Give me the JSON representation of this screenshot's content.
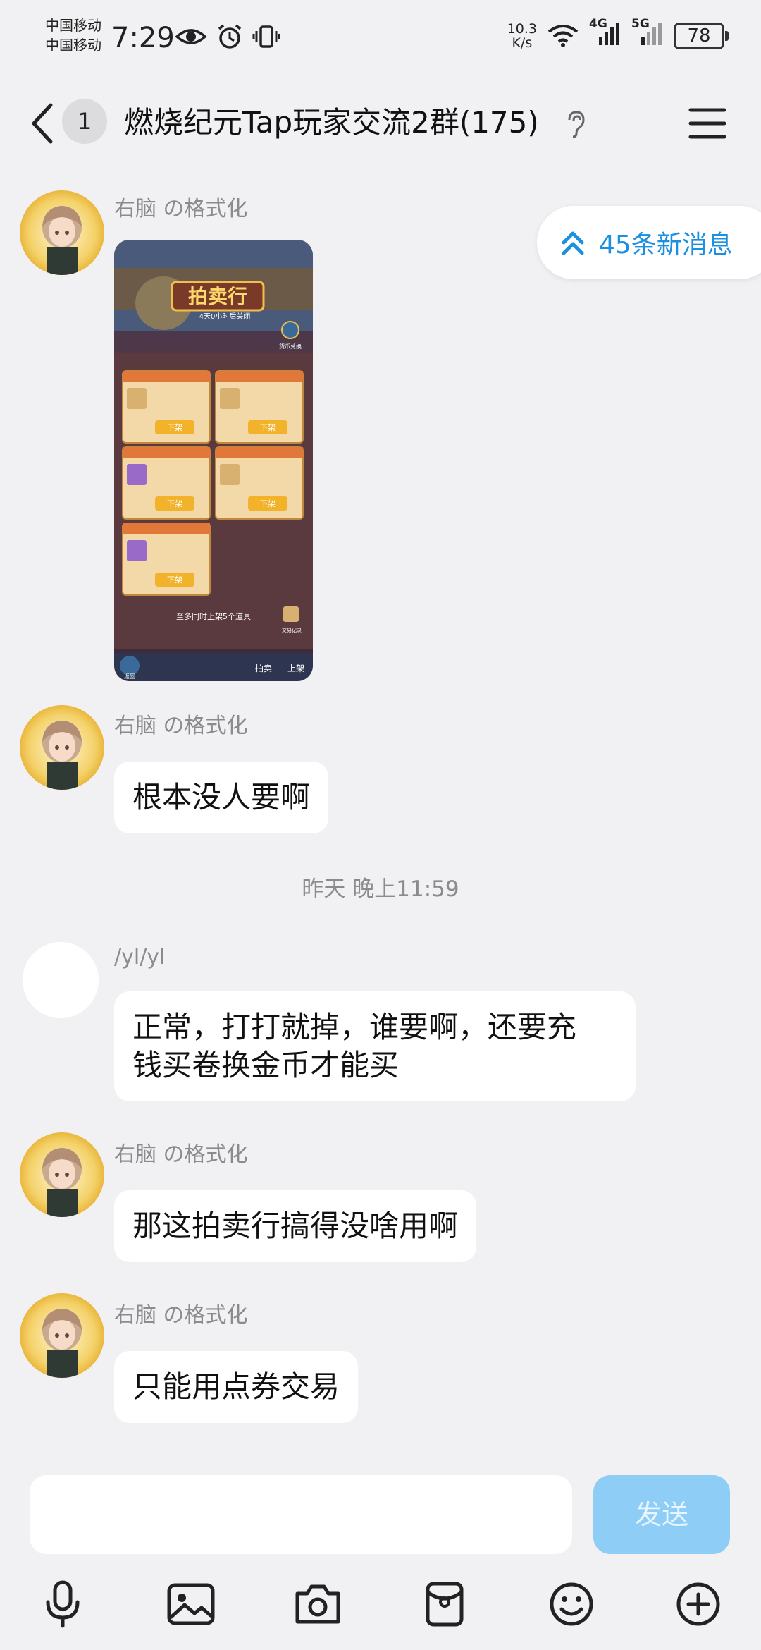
{
  "status_bar": {
    "carrier_1": "中国移动",
    "carrier_2": "中国移动",
    "time": "7:29",
    "net_speed_value": "10.3",
    "net_speed_unit": "K/s",
    "net_4g": "4G",
    "net_5g": "5G",
    "battery": "78"
  },
  "header": {
    "unread_count": "1",
    "title": "燃烧纪元Tap玩家交流2群(175)"
  },
  "new_messages_pill": "45条新消息",
  "messages": [
    {
      "sender": "右脑 の格式化",
      "type": "image"
    },
    {
      "sender": "右脑 の格式化",
      "text": "根本没人要啊"
    },
    {
      "sender": "/yl/yl",
      "text_line_1": "正常，打打就掉，谁要啊，还要充",
      "text_line_2": "钱买卷换金币才能买"
    },
    {
      "sender": "右脑 の格式化",
      "text": "那这拍卖行搞得没啥用啊"
    },
    {
      "sender": "右脑 の格式化",
      "text": "只能用点券交易"
    }
  ],
  "time_separator": "昨天 晚上11:59",
  "auction_image": {
    "title": "拍卖行",
    "subtitle": "4天0小时后关闭",
    "exchange": "货币兑换",
    "unlist_label": "下架",
    "footer_text": "至多同时上架5个道具",
    "trade_record": "交易记录",
    "tab_auction": "拍卖",
    "tab_list": "上架",
    "back": "返回"
  },
  "composer": {
    "input_value": "",
    "send_label": "发送"
  },
  "toolbar": {
    "icons": [
      "mic-icon",
      "image-icon",
      "camera-icon",
      "red-packet-icon",
      "emoji-icon",
      "plus-icon"
    ]
  },
  "colors": {
    "background": "#f1f1f3",
    "accent": "#1b8fe0",
    "send_disabled": "#8ecdf5"
  }
}
